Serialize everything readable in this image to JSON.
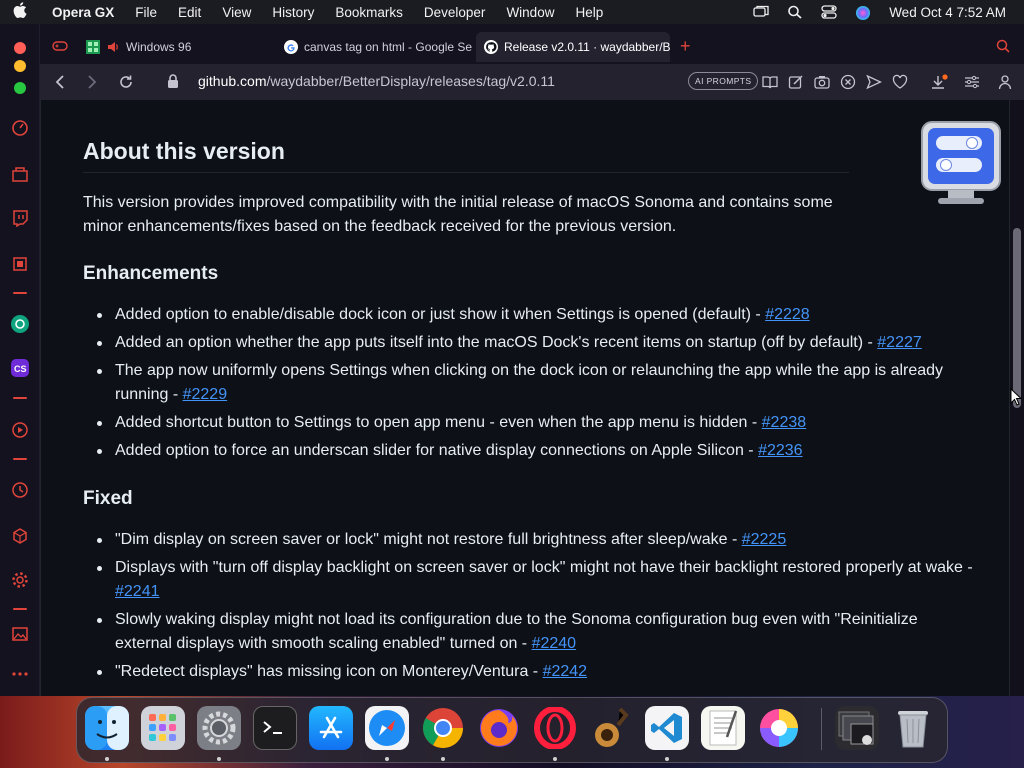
{
  "menubar": {
    "app_name": "Opera GX",
    "items": [
      "File",
      "Edit",
      "View",
      "History",
      "Bookmarks",
      "Developer",
      "Window",
      "Help"
    ],
    "datetime": "Wed Oct 4  7:52 AM"
  },
  "tabs": [
    {
      "label": "Windows 96",
      "icon": "windows96-icon"
    },
    {
      "label": "canvas tag on html - Google Se",
      "icon": "google-icon"
    },
    {
      "label": "Release v2.0.11 · waydabber/Be",
      "icon": "github-icon",
      "active": true
    }
  ],
  "address": {
    "domain": "github.com",
    "path": "/waydabber/BetterDisplay/releases/tag/v2.0.11"
  },
  "toolbar": {
    "ai_prompts": "AI PROMPTS"
  },
  "release": {
    "heading": "About this version",
    "intro": "This version provides improved compatibility with the initial release of macOS Sonoma and contains some minor enhancements/fixes based on the feedback received for the previous version.",
    "enhancements_heading": "Enhancements",
    "enhancements": [
      {
        "text": "Added option to enable/disable dock icon or just show it when Settings is opened (default) - ",
        "link": "#2228"
      },
      {
        "text": "Added an option whether the app puts itself into the macOS Dock's recent items on startup (off by default) - ",
        "link": "#2227"
      },
      {
        "text": "The app now uniformly opens Settings when clicking on the dock icon or relaunching the app while the app is already running - ",
        "link": "#2229"
      },
      {
        "text": "Added shortcut button to Settings to open app menu - even when the app menu is hidden - ",
        "link": "#2238"
      },
      {
        "text": "Added option to force an underscan slider for native display connections on Apple Silicon - ",
        "link": "#2236"
      }
    ],
    "fixed_heading": "Fixed",
    "fixed": [
      {
        "text": "\"Dim display on screen saver or lock\" might not restore full brightness after sleep/wake - ",
        "link": "#2225"
      },
      {
        "text": "Displays with \"turn off display backlight on screen saver or lock\" might not have their backlight restored properly at wake - ",
        "link": "#2241"
      },
      {
        "text": "Slowly waking display might not load its configuration due to the Sonoma configuration bug even with \"Reinitialize external displays with smooth scaling enabled\" turned on - ",
        "link": "#2240"
      },
      {
        "text": "\"Redetect displays\" has missing icon on Monterey/Ventura - ",
        "link": "#2242"
      }
    ]
  },
  "dock": [
    "Finder",
    "Launchpad",
    "System Settings",
    "Terminal",
    "App Store",
    "Safari",
    "Chrome",
    "Firefox",
    "Opera GX",
    "GarageBand",
    "VS Code",
    "TextEdit",
    "Pixelmator",
    "Downloads Stack",
    "Trash"
  ],
  "colors": {
    "link": "#4493f8",
    "page_bg": "#0d1117",
    "opera_accent": "#e0443a"
  }
}
